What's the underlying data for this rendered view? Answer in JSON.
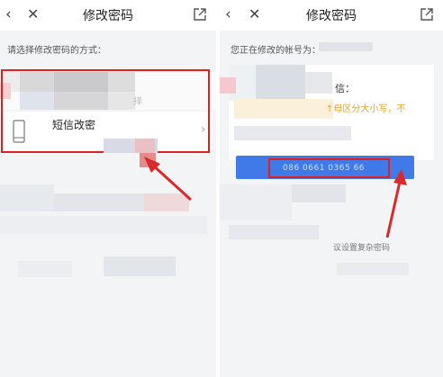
{
  "left_screen": {
    "header": {
      "back_icon": "back-chevron-icon",
      "close_icon": "close-x-icon",
      "title": "修改密码",
      "share_icon": "share-external-icon"
    },
    "prompt": "请选择修改密码的方式：",
    "option_sms": {
      "label": "短信改密",
      "icon": "phone-icon"
    },
    "option_partial": "择"
  },
  "right_screen": {
    "header": {
      "back_icon": "back-chevron-icon",
      "close_icon": "close-x-icon",
      "title": "修改密码",
      "share_icon": "share-external-icon"
    },
    "account_prefix": "您正在修改的帐号为：",
    "sms_fragment": "信：",
    "case_note": "↑母区分大小写，不",
    "button_number": "086 0661 0365 66",
    "hint": "议设置复杂密码"
  },
  "colors": {
    "red_highlight": "#e02020",
    "blue_button": "#3f7ae8",
    "orange_note": "#f0a020"
  }
}
